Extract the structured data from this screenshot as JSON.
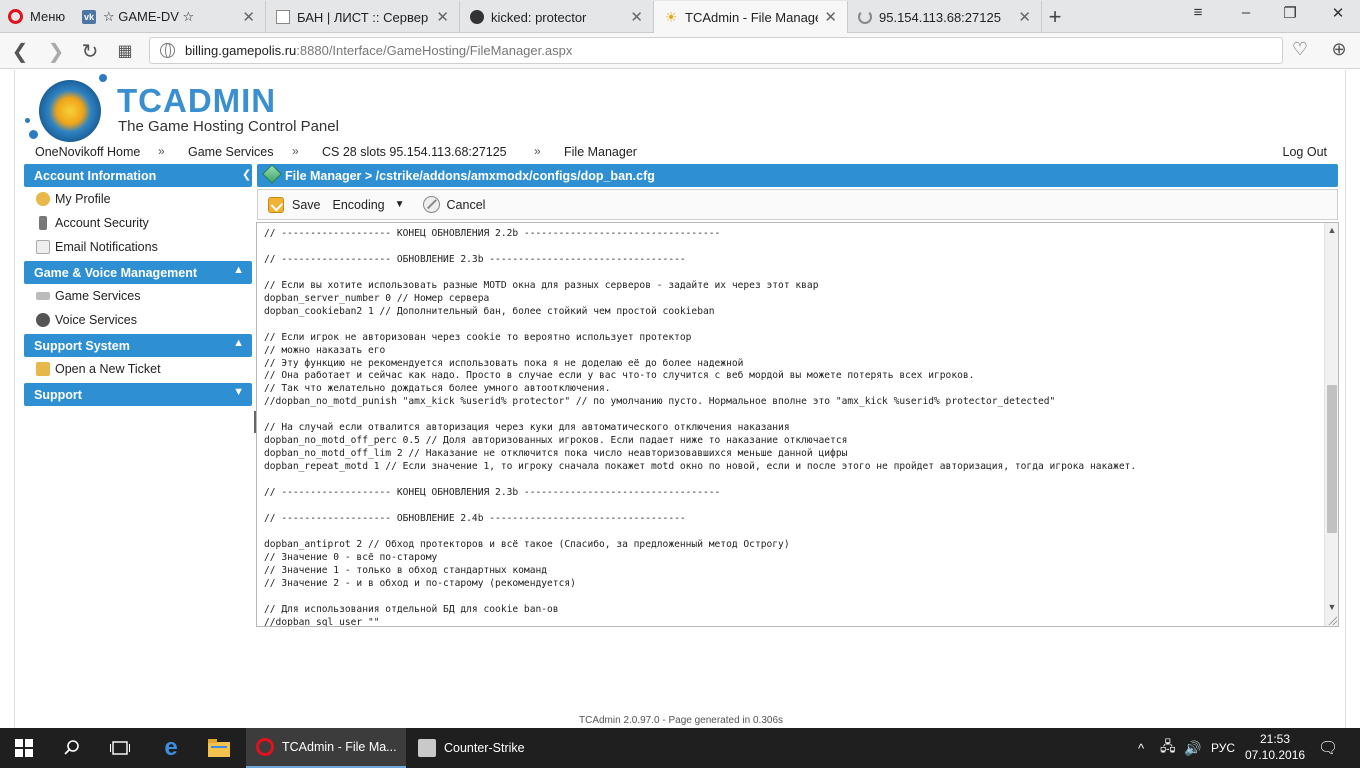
{
  "browser": {
    "menu_label": "Меню",
    "tabs": [
      {
        "title": "☆ GAME-DV ☆",
        "favicon": "vk-icon",
        "close": "✕"
      },
      {
        "title": "БАН | ЛИСТ :: Сервер *[VL",
        "favicon": "page-icon",
        "close": "✕"
      },
      {
        "title": "kicked: protector",
        "favicon": "github-icon",
        "close": "✕"
      },
      {
        "title": "TCAdmin - File Manager",
        "favicon": "sun-icon",
        "close": "✕"
      },
      {
        "title": "95.154.113.68:27125",
        "favicon": "loading-icon",
        "close": "✕"
      }
    ],
    "url_host": "billing.gamepolis.ru",
    "url_rest": ":8880/Interface/GameHosting/FileManager.aspx"
  },
  "logo": {
    "title": "TCADMIN",
    "subtitle": "The Game Hosting Control Panel"
  },
  "breadcrumb": {
    "items": [
      "OneNovikoff Home",
      "Game Services",
      "CS 28 slots 95.154.113.68:27125",
      "File Manager"
    ],
    "separator": "»",
    "logout": "Log Out"
  },
  "sidebar": {
    "sections": [
      {
        "title": "Account Information",
        "items": [
          "My Profile",
          "Account Security",
          "Email Notifications"
        ]
      },
      {
        "title": "Game & Voice Management",
        "items": [
          "Game Services",
          "Voice Services"
        ]
      },
      {
        "title": "Support System",
        "items": [
          "Open a New Ticket"
        ]
      },
      {
        "title": "Support",
        "items": []
      }
    ]
  },
  "file_manager": {
    "title": "File Manager > /cstrike/addons/amxmodx/configs/dop_ban.cfg",
    "save_label": "Save",
    "encoding_label": "Encoding",
    "cancel_label": "Cancel",
    "content": "// ------------------- КОНЕЦ ОБНОВЛЕНИЯ 2.2b ----------------------------------\n\n// ------------------- ОБНОВЛЕНИЕ 2.3b ----------------------------------\n\n// Если вы хотите использовать разные MOTD окна для разных серверов - задайте их через этот квар\ndopban_server_number 0 // Номер сервера\ndopban_cookieban2 1 // Дополнительный бан, более стойкий чем простой cookieban\n\n// Если игрок не авторизован через cookie то вероятно использует протектор\n// можно наказать его\n// Эту функцию не рекомендуется использовать пока я не доделаю её до более надежной\n// Она работает и сейчас как надо. Просто в случае если у вас что-то случится с веб мордой вы можете потерять всех игроков.\n// Так что желательно дождаться более умного автоотключения.\n//dopban_no_motd_punish \"amx_kick %userid% protector\" // по умолчанию пусто. Нормальное вполне это \"amx_kick %userid% protector_detected\"\n\n// На случай если отвалится авторизация через куки для автоматического отключения наказания\ndopban_no_motd_off_perc 0.5 // Доля авторизованных игроков. Если падает ниже то наказание отключается\ndopban_no_motd_off_lim 2 // Наказание не отключится пока число неавторизовавшихся меньше данной цифры\ndopban_repeat_motd 1 // Если значение 1, то игроку сначала покажет motd окно по новой, если и после этого не пройдет авторизация, тогда игрока накажет.\n\n// ------------------- КОНЕЦ ОБНОВЛЕНИЯ 2.3b ----------------------------------\n\n// ------------------- ОБНОВЛЕНИЕ 2.4b ----------------------------------\n\ndopban_antiprot 2 // Обход протекторов и всё такое (Спасибо, за предложенный метод Острогу)\n// Значение 0 - всё по-старому\n// Значение 1 - только в обход стандартных команд\n// Значение 2 - и в обход и по-старому (рекомендуется)\n\n// Для использования отдельной БД для cookie ban-ов\n//dopban_sql_user \"\""
  },
  "footer": {
    "text": "TCAdmin 2.0.97.0 - Page generated in 0.306s"
  },
  "taskbar": {
    "apps": [
      {
        "label": "TCAdmin - File Ma...",
        "icon": "opera-icon"
      },
      {
        "label": "Counter-Strike",
        "icon": "counter-strike-icon"
      }
    ],
    "language": "РУС",
    "time": "21:53",
    "date": "07.10.2016"
  },
  "colors": {
    "accent": "#2f8fd3",
    "opera": "#e2111d",
    "taskbar": "#1f1f1f"
  }
}
